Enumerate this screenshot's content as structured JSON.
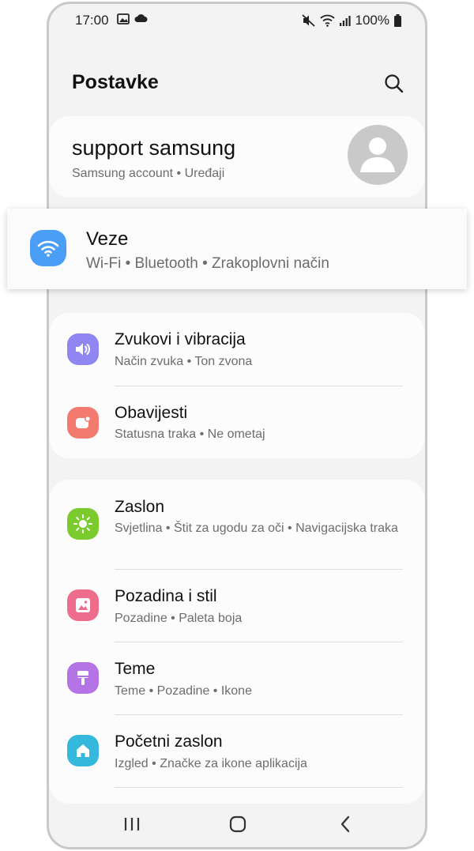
{
  "status_bar": {
    "time": "17:00",
    "battery": "100%"
  },
  "header": {
    "title": "Postavke"
  },
  "account": {
    "name": "support samsung",
    "subtitle": "Samsung account  •  Uređaji"
  },
  "highlight": {
    "title": "Veze",
    "subtitle": "Wi-Fi  •  Bluetooth  •  Zrakoplovni način",
    "icon": "wifi-icon",
    "color": "#4b9ef6"
  },
  "group1": [
    {
      "title": "Zvukovi i vibracija",
      "subtitle": "Način zvuka  •  Ton zvona",
      "icon": "speaker-icon",
      "color": "#8f86f2"
    },
    {
      "title": "Obavijesti",
      "subtitle": "Statusna traka  •  Ne ometaj",
      "icon": "notification-icon",
      "color": "#f27a6e"
    }
  ],
  "group2": [
    {
      "title": "Zaslon",
      "subtitle": "Svjetlina  •  Štit za ugodu za oči  •  Navigacijska traka",
      "icon": "brightness-icon",
      "color": "#7ccb2e"
    },
    {
      "title": "Pozadina i stil",
      "subtitle": "Pozadine  •  Paleta boja",
      "icon": "image-icon",
      "color": "#ef6d8c"
    },
    {
      "title": "Teme",
      "subtitle": "Teme  •  Pozadine  •  Ikone",
      "icon": "brush-icon",
      "color": "#b574e6"
    },
    {
      "title": "Početni zaslon",
      "subtitle": "Izgled  •  Značke za ikone aplikacija",
      "icon": "home-icon",
      "color": "#34b8dc"
    }
  ]
}
